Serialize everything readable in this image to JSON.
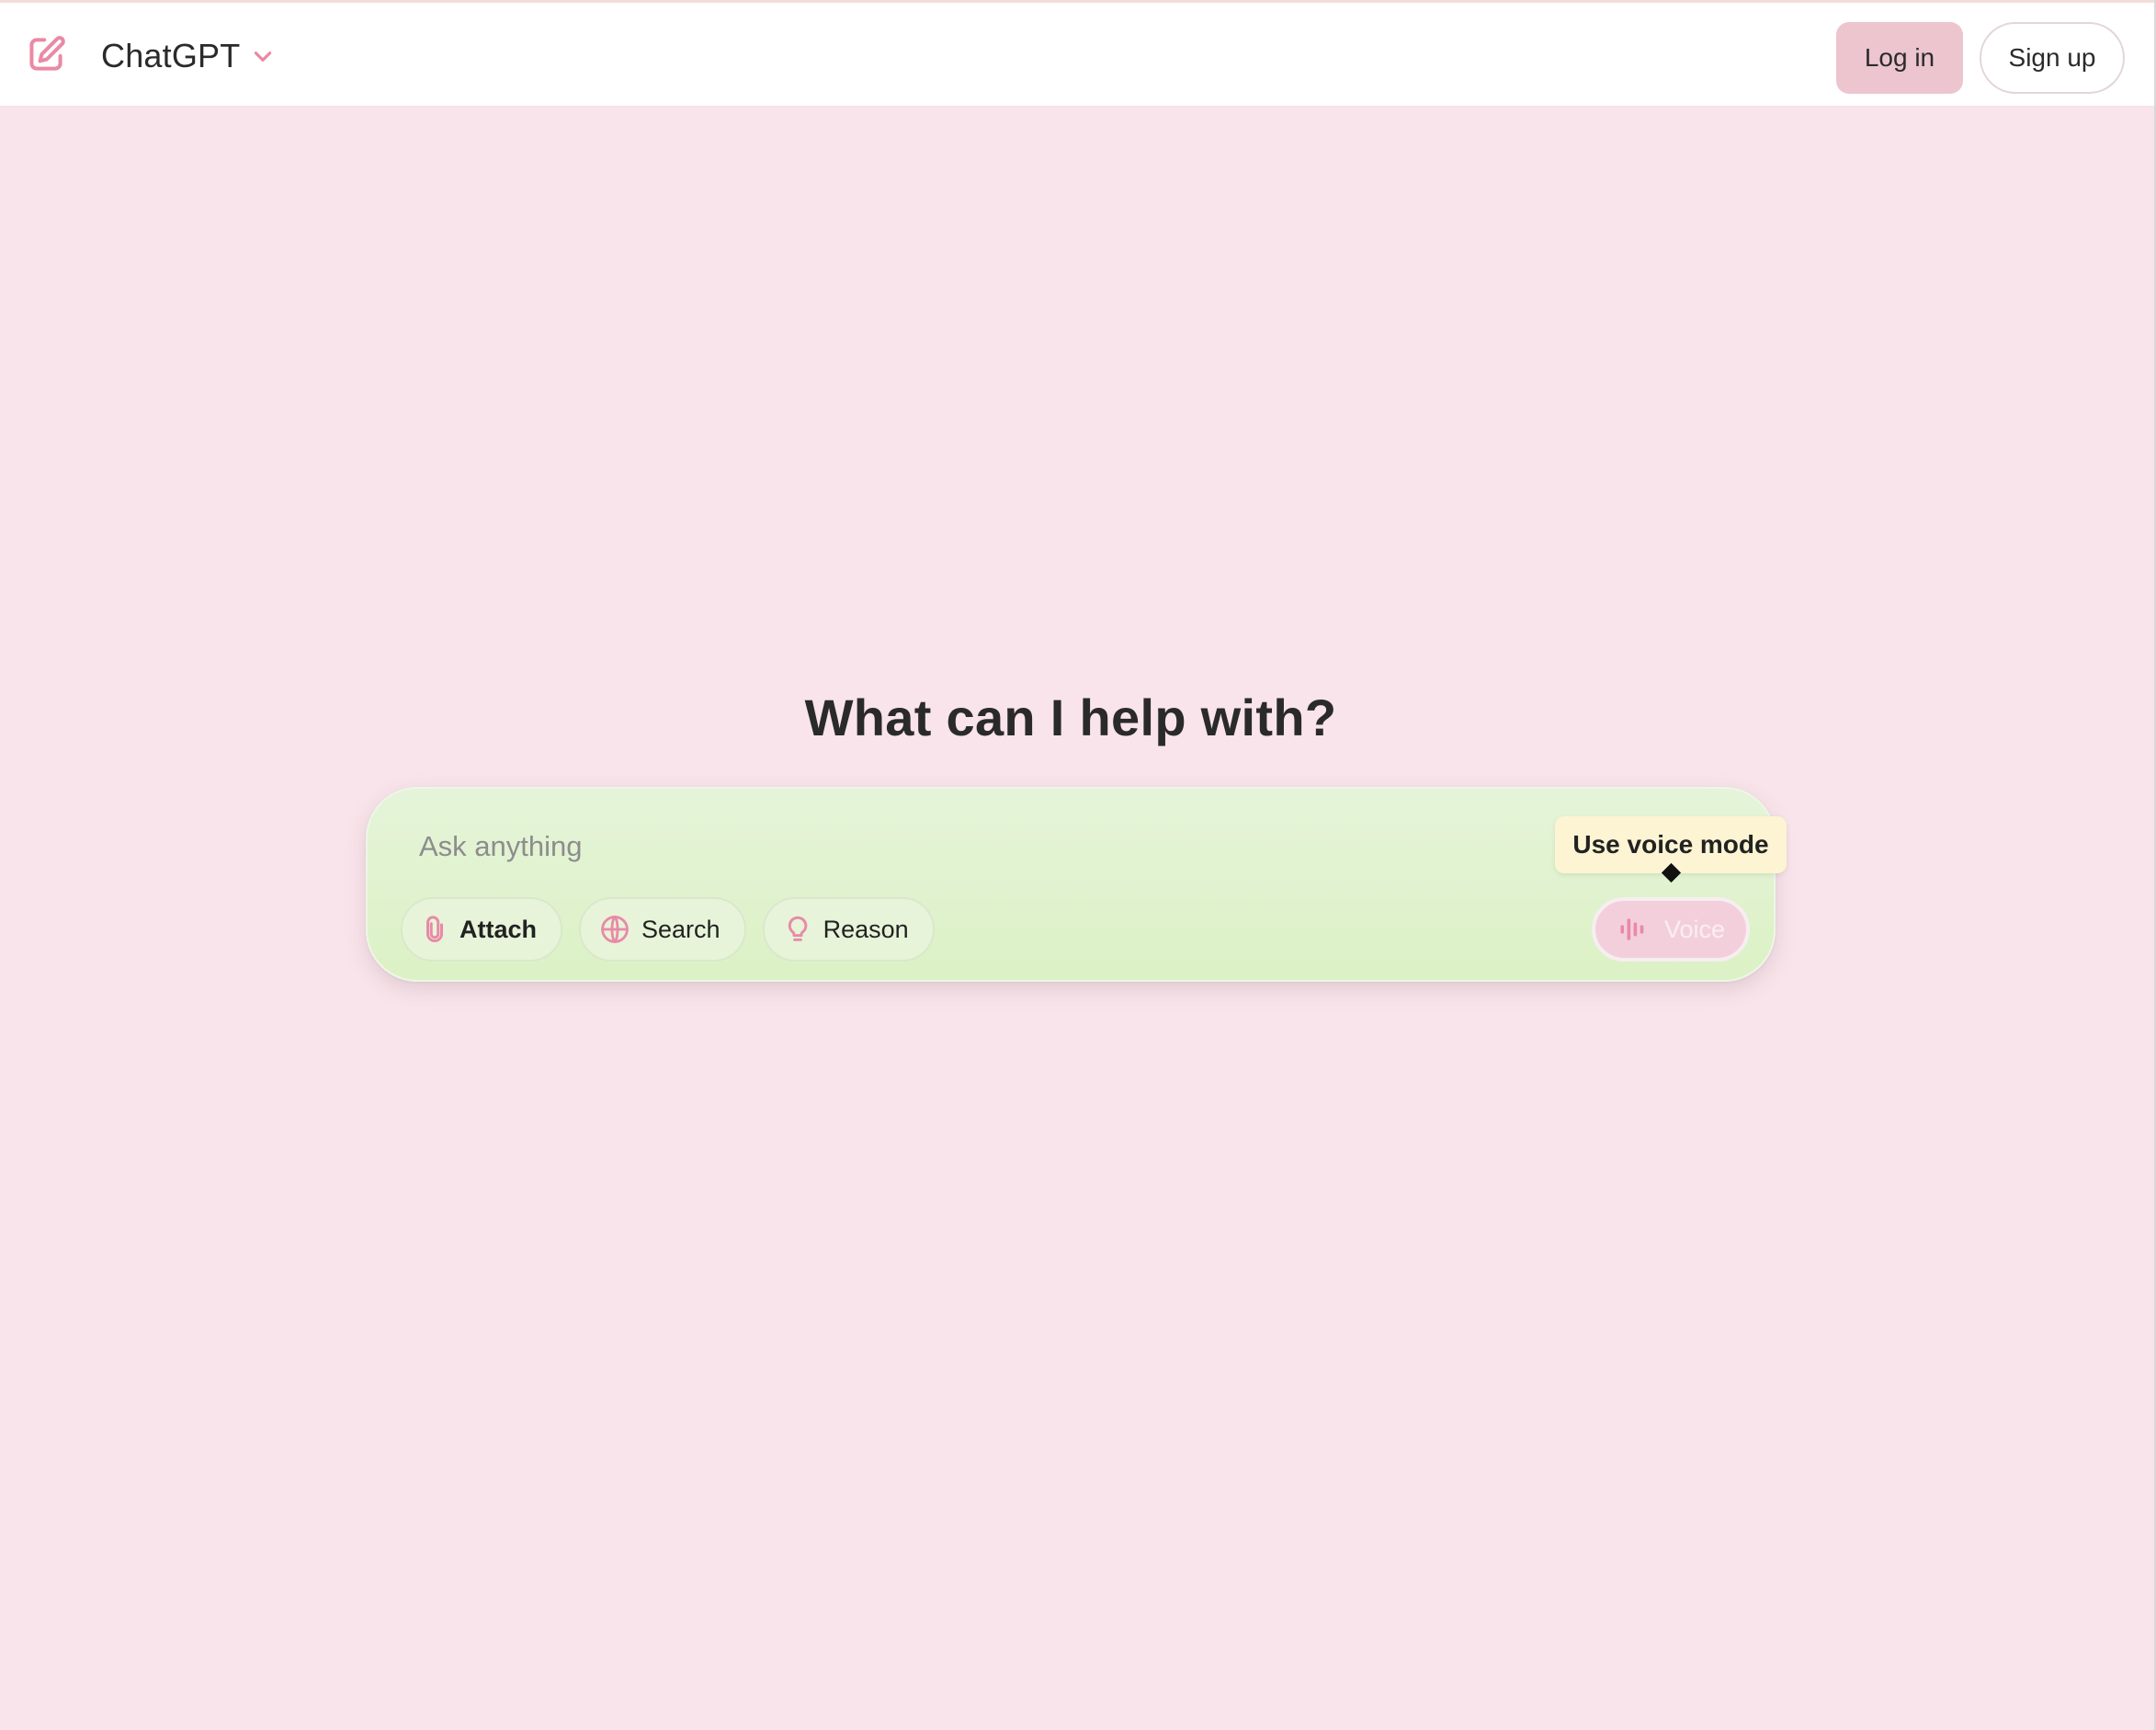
{
  "header": {
    "model_name": "ChatGPT",
    "login_label": "Log in",
    "signup_label": "Sign up"
  },
  "main": {
    "headline": "What can I help with?",
    "composer": {
      "placeholder": "Ask anything",
      "tools": [
        {
          "label": "Attach",
          "icon": "paperclip-icon"
        },
        {
          "label": "Search",
          "icon": "globe-icon"
        },
        {
          "label": "Reason",
          "icon": "lightbulb-icon"
        }
      ],
      "voice_label": "Voice",
      "voice_icon": "waveform-icon"
    },
    "tooltip": "Use voice mode"
  },
  "colors": {
    "accent": "#e98aa6",
    "page_bg": "#f8e4ea",
    "composer_bg": "#dcf1c5",
    "login_bg": "#ecc5cf",
    "tooltip_bg": "#fcf4d2"
  }
}
